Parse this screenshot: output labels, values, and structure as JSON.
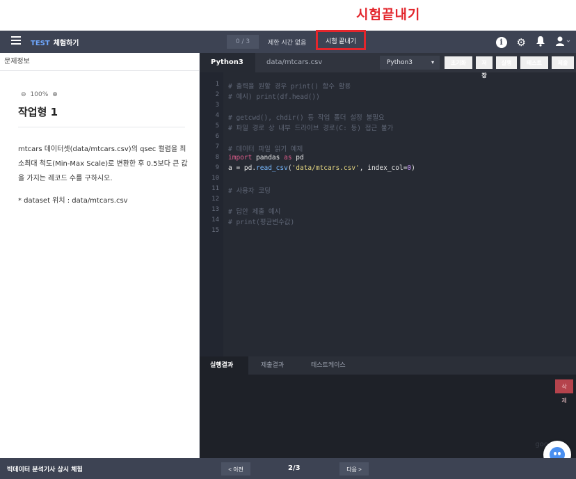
{
  "annotation": {
    "text": "시험끝내기"
  },
  "topbar": {
    "brand_highlight": "TEST",
    "brand_rest": "체험하기",
    "counter": "0 / 3",
    "time_text": "제한 시간 없음",
    "end_exam_label": "시험 끝내기",
    "icons": [
      "info-icon",
      "gear-icon",
      "bell-icon",
      "user-icon"
    ]
  },
  "left_panel": {
    "header": "문제정보",
    "zoom": {
      "minus": "⊖",
      "value": "100%",
      "plus": "⊕"
    },
    "task_title": "작업형 1",
    "description": "mtcars 데이터셋(data/mtcars.csv)의 qsec 컬럼을 최소최대 척도(Min-Max Scale)로 변환한 후 0.5보다 큰 값을 가지는 레코드 수를 구하시오.",
    "dataset_note": "* dataset 위치 : data/mtcars.csv"
  },
  "editor": {
    "tabs": [
      "Python3",
      "data/mtcars.csv"
    ],
    "active_tab": 0,
    "language": "Python3",
    "buttons": [
      {
        "label": "초기화",
        "color": "#3a8bd8"
      },
      {
        "label": "저장",
        "color": "#3a8bd8"
      },
      {
        "label": "실행",
        "color": "#3a8bd8"
      },
      {
        "label": "테스트",
        "color": "#3a8bd8"
      },
      {
        "label": "제출",
        "color": "#2bbcaa"
      }
    ],
    "lines": [
      "# 출력을 원할 경우 print() 함수 활용",
      "# 예시) print(df.head())",
      "",
      "# getcwd(), chdir() 등 작업 폴더 설정 불필요",
      "# 파일 경로 상 내부 드라이브 경로(C: 등) 접근 불가",
      "",
      "# 데이터 파일 읽기 예제",
      "import pandas as pd",
      "a = pd.read_csv('data/mtcars.csv', index_col=0)",
      "",
      "# 사용자 코딩",
      "",
      "# 답안 제출 예시",
      "# print(평균변수값)",
      ""
    ]
  },
  "results": {
    "tabs": [
      "실행결과",
      "제출결과",
      "테스트케이스"
    ],
    "active_tab": 0,
    "delete_label": "삭제",
    "watermark": "goo"
  },
  "footer": {
    "title": "빅데이터 분석기사 상시 체험",
    "prev_label": "< 이전",
    "page": "2/3",
    "next_label": "다음 >"
  },
  "colors": {
    "annotation_red": "#e3262c",
    "topbar": "#3d4353",
    "editor_bg": "#262a33"
  }
}
